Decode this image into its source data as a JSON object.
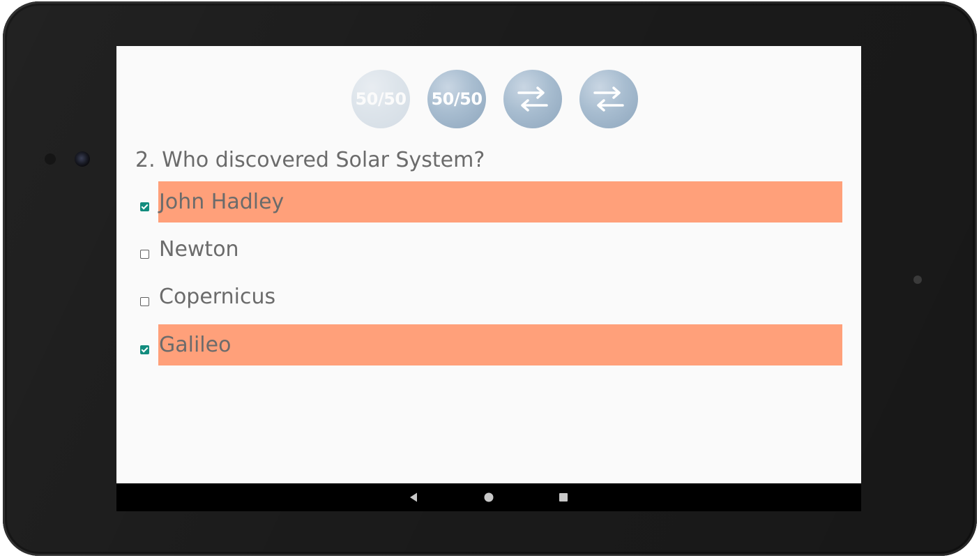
{
  "lifelines": [
    {
      "label": "50/50",
      "icon": "fifty-fifty-icon",
      "state": "used"
    },
    {
      "label": "50/50",
      "icon": "fifty-fifty-icon",
      "state": "available"
    },
    {
      "label": "",
      "icon": "swap-arrows-icon",
      "state": "available"
    },
    {
      "label": "",
      "icon": "swap-arrows-icon",
      "state": "available"
    }
  ],
  "question": {
    "text": "2. Who discovered Solar System?"
  },
  "options": [
    {
      "label": "John Hadley",
      "checked": true
    },
    {
      "label": "Newton",
      "checked": false
    },
    {
      "label": "Copernicus",
      "checked": false
    },
    {
      "label": "Galileo",
      "checked": true
    }
  ],
  "nav": {
    "back_icon": "back-triangle-icon",
    "home_icon": "home-circle-icon",
    "recents_icon": "recents-square-icon"
  },
  "colors": {
    "selected_highlight": "#ffa07a",
    "checkbox_checked": "#128c7e",
    "text": "#6b6b6b",
    "screen_bg": "#fafafa"
  }
}
